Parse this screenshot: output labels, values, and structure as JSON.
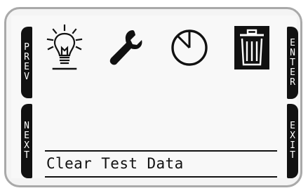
{
  "softkeys": {
    "prev": [
      "P",
      "R",
      "E",
      "V"
    ],
    "next": [
      "N",
      "E",
      "X",
      "T"
    ],
    "enter": [
      "E",
      "N",
      "T",
      "E",
      "R"
    ],
    "exit": [
      "E",
      "X",
      "I",
      "T"
    ]
  },
  "menu": {
    "icons": [
      "lightbulb-icon",
      "wrench-icon",
      "clock-icon",
      "trash-icon"
    ],
    "selected_index": 3,
    "selected_label": "Clear Test Data"
  },
  "colors": {
    "lcd_ink": "#111111",
    "lcd_background": "#f8f8f8",
    "frame": "#a9a9a9"
  }
}
